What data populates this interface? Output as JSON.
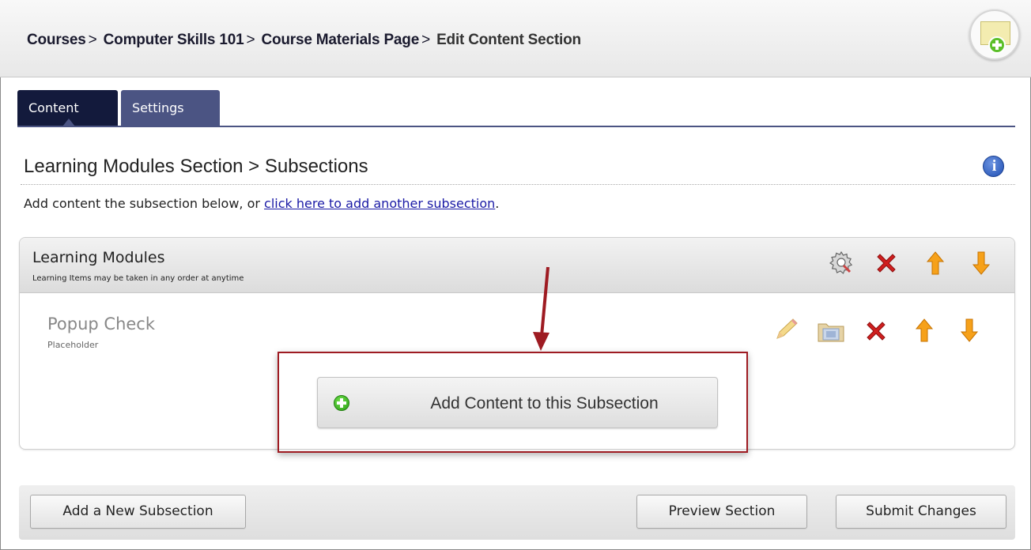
{
  "breadcrumb": {
    "items": [
      "Courses",
      "Computer Skills 101",
      "Course Materials Page"
    ],
    "separator": ">",
    "current": "Edit Content Section"
  },
  "tabs": [
    {
      "label": "Content",
      "active": true
    },
    {
      "label": "Settings",
      "active": false
    }
  ],
  "section": {
    "title": "Learning Modules Section > Subsections",
    "intro_text": "Add content the subsection below, or ",
    "intro_link": "click here to add another subsection",
    "intro_end": "."
  },
  "panel": {
    "title": "Learning Modules",
    "subtitle": "Learning Items may be taken in any order at anytime"
  },
  "item": {
    "title": "Popup Check",
    "subtitle": "Placeholder"
  },
  "add_content_label": "Add Content to this Subsection",
  "footer": {
    "add_subsection": "Add a New Subsection",
    "preview": "Preview Section",
    "submit": "Submit Changes"
  },
  "icons": {
    "info": "info-icon",
    "gear": "gear-icon",
    "delete": "delete-icon",
    "up": "arrow-up-icon",
    "down": "arrow-down-icon",
    "edit": "pencil-icon",
    "folder": "folder-icon",
    "add": "plus-icon"
  },
  "colors": {
    "tab_active": "#131a3c",
    "tab_inactive": "#4b5483",
    "highlight": "#9e1b22",
    "link": "#1a1aa6"
  }
}
